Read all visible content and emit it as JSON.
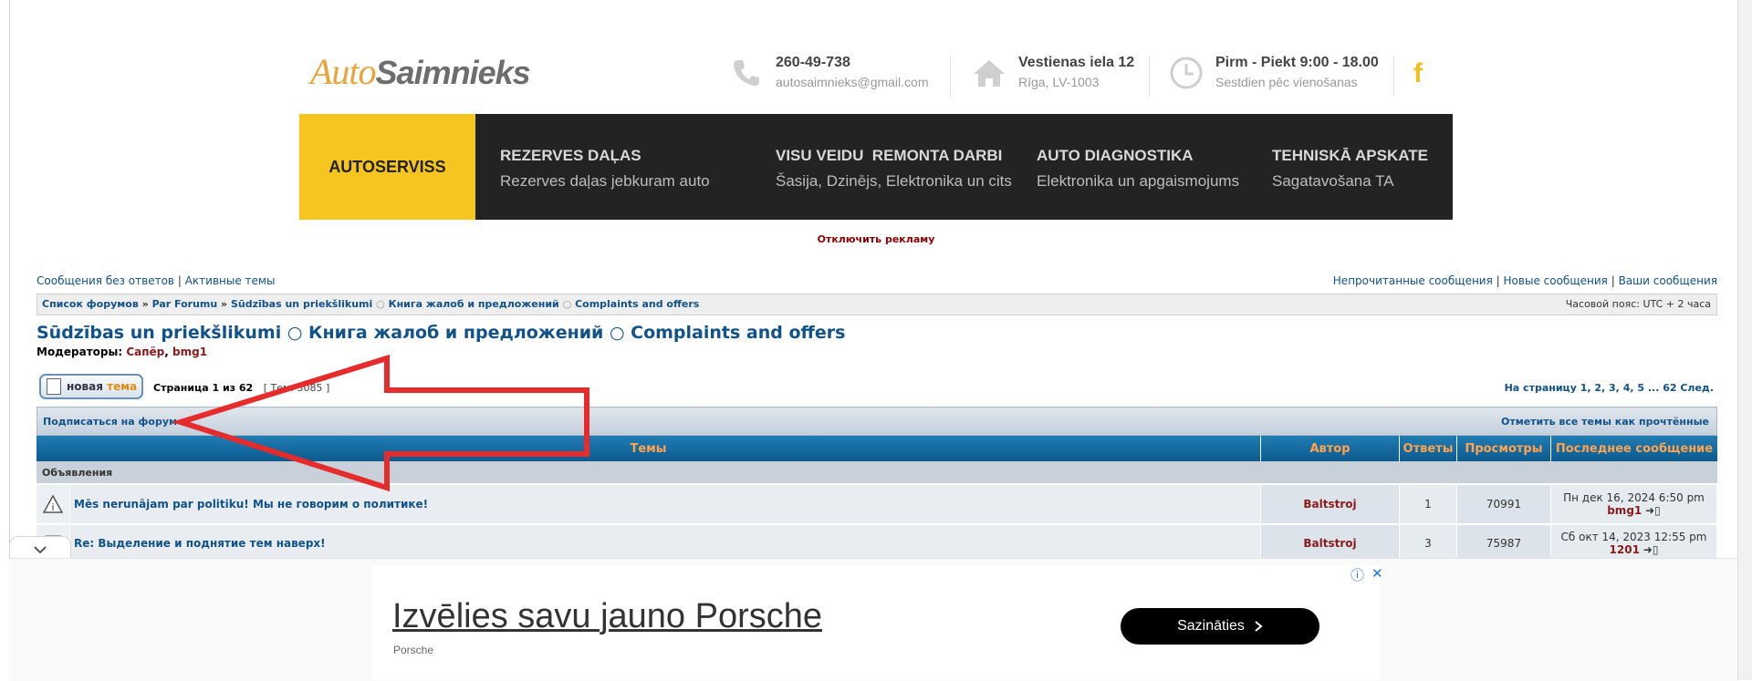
{
  "header": {
    "logo_part1": "Auto",
    "logo_part2": "Saimnieks",
    "phone": "260-49-738",
    "email": "autosaimnieks@gmail.com",
    "address_line1": "Vestienas iela 12",
    "address_line2": "Rīga, LV-1003",
    "hours_line1": "Pirm - Piekt 9:00 - 18.00",
    "hours_line2": "Sestdien pēc vienošanas",
    "facebook": "f"
  },
  "nav": {
    "first": "AUTOSERVISS",
    "items": [
      {
        "title": "REZERVES DAĻAS",
        "sub": "Rezerves daļas jebkuram auto"
      },
      {
        "title": "VISU VEIDU  REMONTA DARBI",
        "sub": "Šasija, Dzinējs, Elektronika un cits"
      },
      {
        "title": "AUTO DIAGNOSTIKA",
        "sub": "Elektronika un apgaismojums"
      },
      {
        "title": "TEHNISKĀ APSKATE",
        "sub": "Sagatavošana TA"
      }
    ]
  },
  "ad_off": "Отключить рекламу",
  "toplinks": {
    "left": [
      "Сообщения без ответов",
      "Активные темы"
    ],
    "right": [
      "Непрочитанные сообщения",
      "Новые сообщения",
      "Ваши сообщения"
    ],
    "sep": "|"
  },
  "breadcrumb": {
    "items": [
      "Список форумов",
      "Par Forumu",
      "Sūdzības un priekšlikumi",
      "Книга жалоб и предложений",
      "Complaints and offers"
    ],
    "sep_main": "»",
    "sep_sub": "○",
    "timezone": "Часовой пояс: UTC + 2 часа"
  },
  "forum": {
    "title": "Sūdzības un priekšlikumi ○ Книга жалоб и предложений ○ Complaints and offers",
    "mods_label": "Модераторы:",
    "mods": [
      "Сапёр",
      "bmg1"
    ],
    "new_topic_label1": "новая",
    "new_topic_label2": "тема",
    "page_info": "Страница 1 из 62",
    "topic_count": "[ Тем: 3085 ]",
    "pagination": "На страницу 1, 2, 3, 4, 5 ... 62  След.",
    "subscribe": "Подписаться на форум",
    "mark_read": "Отметить все темы как прочтённые"
  },
  "table": {
    "headers": [
      "Темы",
      "Автор",
      "Ответы",
      "Просмотры",
      "Последнее сообщение"
    ],
    "section": "Объявления",
    "rows": [
      {
        "topic": "Mēs nerunājam par politiku! Мы не говорим о политике!",
        "author": "Baltstroj",
        "replies": "1",
        "views": "70991",
        "last_date": "Пн дек 16, 2024 6:50 pm",
        "last_by": "bmg1"
      },
      {
        "topic": "Re: Выделение и поднятие тем наверх!",
        "author": "Baltstroj",
        "replies": "3",
        "views": "75987",
        "last_date": "Сб окт 14, 2023 12:55 pm",
        "last_by": "1201"
      }
    ]
  },
  "ad": {
    "headline": "Izvēlies savu jauno Porsche",
    "brand": "Porsche",
    "button": "Sazināties",
    "info_icons": [
      "ⓘ",
      "✕"
    ]
  },
  "colors": {
    "link": "#105289",
    "header_bar": "#0d5b8f",
    "header_text": "#ffa34f",
    "accent_yellow": "#f7c51f",
    "arrow_red": "#e52b2b"
  }
}
